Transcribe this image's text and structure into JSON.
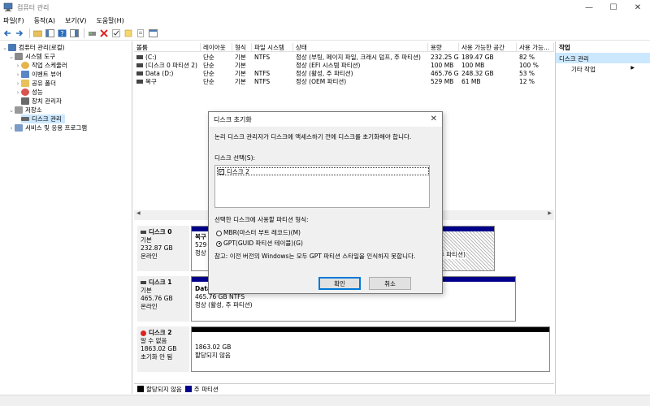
{
  "window": {
    "title": "컴퓨터 관리",
    "min": "—",
    "max": "☐",
    "close": "✕"
  },
  "menu": [
    "파일(F)",
    "동작(A)",
    "보기(V)",
    "도움말(H)"
  ],
  "tree": {
    "root": "컴퓨터 관리(로컬)",
    "system_tools": "시스템 도구",
    "task_scheduler": "작업 스케줄러",
    "event_viewer": "이벤트 뷰어",
    "shared_folders": "공유 폴더",
    "performance": "성능",
    "device_manager": "장치 관리자",
    "storage": "저장소",
    "disk_management": "디스크 관리",
    "services": "서비스 및 응용 프로그램"
  },
  "volumes": {
    "headers": [
      "볼륨",
      "레이아웃",
      "형식",
      "파일 시스템",
      "상태",
      "용량",
      "사용 가능한 공간",
      "사용 가능..."
    ],
    "rows": [
      [
        "(C:)",
        "단순",
        "기본",
        "NTFS",
        "정상 (부팅, 페이지 파일, 크래시 덤프, 주 파티션)",
        "232.25 GB",
        "189.47 GB",
        "82 %"
      ],
      [
        "(디스크 0 파티션 2)",
        "단순",
        "기본",
        "",
        "정상 (EFI 시스템 파티션)",
        "100 MB",
        "100 MB",
        "100 %"
      ],
      [
        "Data (D:)",
        "단순",
        "기본",
        "NTFS",
        "정상 (활성, 주 파티션)",
        "465.76 GB",
        "248.32 GB",
        "53 %"
      ],
      [
        "복구",
        "단순",
        "기본",
        "NTFS",
        "정상 (OEM 파티션)",
        "529 MB",
        "61 MB",
        "12 %"
      ]
    ]
  },
  "disks": [
    {
      "name": "디스크 0",
      "type": "기본",
      "size": "232.87 GB",
      "status": "온라인",
      "part_label": "복구",
      "part_size": "529",
      "part_status": "정상",
      "tail": "주 파티션)"
    },
    {
      "name": "디스크 1",
      "type": "기본",
      "size": "465.76 GB",
      "status": "온라인",
      "part_label": "Data",
      "part_size": "465.76 GB NTFS",
      "part_status": "정상 (활성, 주 파티션)"
    },
    {
      "name": "디스크 2",
      "type": "알 수 없음",
      "size": "1863.02 GB",
      "status": "초기화 안 됨",
      "part_size": "1863.02 GB",
      "part_status": "할당되지 않음"
    }
  ],
  "legend": {
    "unallocated": "할당되지 않음",
    "primary": "주 파티션"
  },
  "actions": {
    "header": "작업",
    "selected": "디스크 관리",
    "more": "기타 작업",
    "more_arrow": "▶"
  },
  "dialog": {
    "title": "디스크 초기화",
    "intro": "논리 디스크 관리자가 디스크에 액세스하기 전에 디스크를 초기화해야 합니다.",
    "select_label": "디스크 선택(S):",
    "disk_item": "디스크 2",
    "style_label": "선택한 디스크에 사용할 파티션 형식:",
    "mbr": "MBR(마스터 부트 레코드)(M)",
    "gpt": "GPT(GUID 파티션 테이블)(G)",
    "note": "참고: 이전 버전의 Windows는 모두 GPT 파티션 스타일을 인식하지 못합니다.",
    "ok": "확인",
    "cancel": "취소",
    "selected_style": "GPT"
  },
  "colors": {
    "primary": "#00008b",
    "unallocated": "#000000",
    "selection": "#cce8ff"
  }
}
